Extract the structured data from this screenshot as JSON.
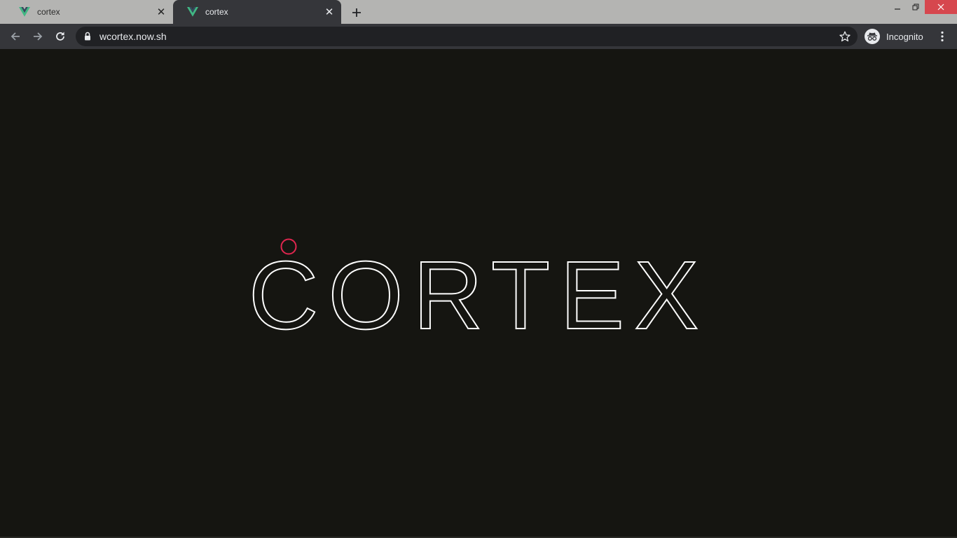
{
  "tabs": [
    {
      "title": "cortex",
      "active": false
    },
    {
      "title": "cortex",
      "active": true
    }
  ],
  "icons": {
    "favicon": "vue-logo-icon",
    "close": "close-icon",
    "new_tab": "plus-icon",
    "back": "arrow-left-icon",
    "forward": "arrow-right-icon",
    "reload": "reload-icon",
    "lock": "lock-icon",
    "bookmark": "star-icon",
    "incognito": "incognito-icon",
    "menu": "kebab-menu-icon"
  },
  "toolbar": {
    "url": "wcortex.now.sh",
    "profile_label": "Incognito"
  },
  "page": {
    "logo_text": "CORTEX"
  },
  "colors": {
    "page_background": "#151511",
    "logo_stroke": "#ffffff",
    "accent_circle": "#e0264f",
    "favicon_green": "#41b883",
    "favicon_dark": "#35495e"
  }
}
